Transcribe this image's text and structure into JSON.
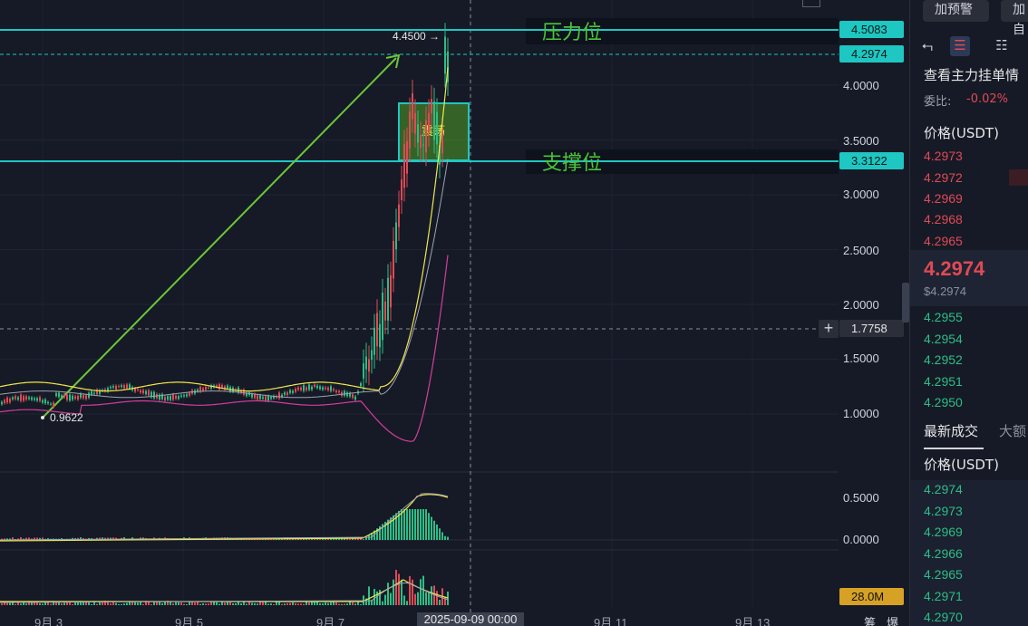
{
  "chart": {
    "y_axis_labels": [
      "4.0000",
      "3.5000",
      "3.0000",
      "2.5000",
      "2.0000",
      "1.5000",
      "1.0000"
    ],
    "oscillator_axis_labels": [
      "0.5000",
      "0.0000"
    ],
    "x_axis_labels": [
      "9月 3",
      "9月 5",
      "9月 7",
      "9月 11",
      "9月 13"
    ],
    "crosshair_time": "2025-09-09 00:00",
    "crosshair_price": "1.7758",
    "resistance_price": "4.5083",
    "last_price_tag": "4.2974",
    "support_price": "3.3122",
    "volume_tag": "28.0M",
    "resistance_label": "压力位",
    "support_label": "支撑位",
    "range_box_label": "震荡",
    "high_marker": "4.4500",
    "low_marker": "0.9622",
    "plus_button": "+",
    "bottom_right_labels": [
      "筹",
      "爆"
    ],
    "colors": {
      "resistance_line": "#1ec7c2",
      "trend_arrow": "#6cc63a",
      "up_candle": "#2ebd85",
      "down_candle": "#e04a55",
      "ma_fast": "#f2e64a",
      "ma_slow": "#9da3b4",
      "lower_band": "#d63c9b"
    }
  },
  "panel": {
    "buttons": [
      "加预警",
      "加自"
    ],
    "icons": [
      "back-icon",
      "orderbook-both-icon",
      "orderbook-list-icon"
    ],
    "orderbook_title": "查看主力挂单情",
    "ratio_label": "委比:",
    "ratio_value": "-0.02%",
    "price_header": "价格(USDT)",
    "asks": [
      "4.2973",
      "4.2972",
      "4.2969",
      "4.2968",
      "4.2965"
    ],
    "last_price": "4.2974",
    "last_price_usd": "$4.2974",
    "bids": [
      "4.2955",
      "4.2954",
      "4.2952",
      "4.2951",
      "4.2950"
    ],
    "trades_tab": "最新成交",
    "trades_tab_2": "大额",
    "trades_header": "价格(USDT)",
    "trades": [
      "4.2974",
      "4.2973",
      "4.2969",
      "4.2966",
      "4.2965",
      "4.2971",
      "4.2970"
    ]
  }
}
